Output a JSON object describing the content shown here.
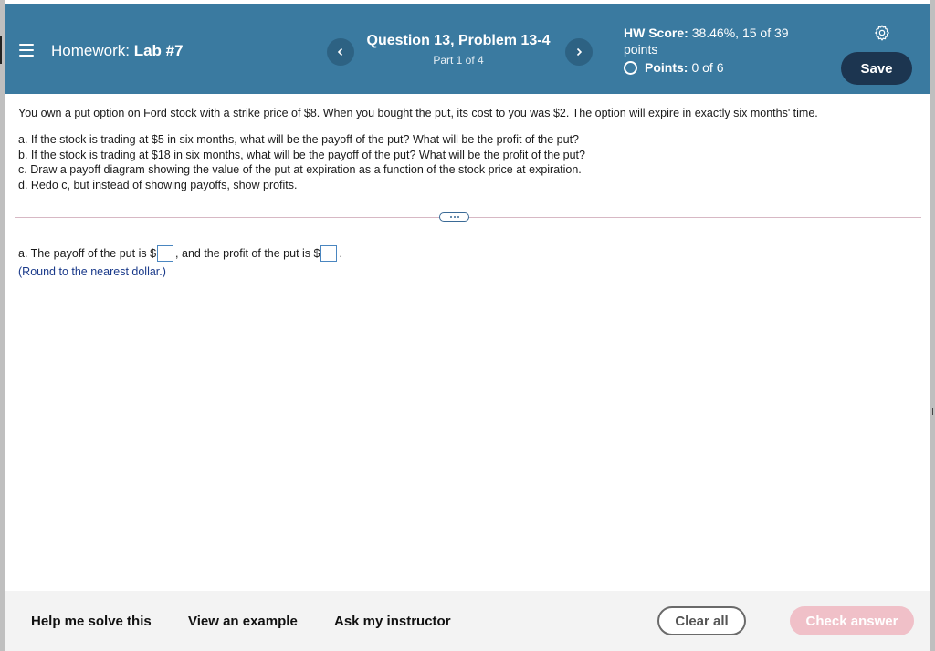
{
  "header": {
    "homework_prefix": "Homework:",
    "homework_name": "Lab #7",
    "question_title": "Question 13, Problem 13-4",
    "question_part": "Part 1 of 4",
    "hw_score_label": "HW Score:",
    "hw_score_value": "38.46%, 15 of 39",
    "hw_score_suffix": "points",
    "points_label": "Points:",
    "points_value": "0 of 6",
    "save_label": "Save",
    "prev_icon": "chevron-left-icon",
    "next_icon": "chevron-right-icon",
    "settings_icon": "gear-icon"
  },
  "problem": {
    "intro": "You own a put option on Ford stock with a strike price of $8. When you bought the put, its cost to you was $2. The option will expire in exactly six months' time.",
    "items": [
      "a. If the stock is trading at $5 in six months, what will be the payoff of the put? What will be the profit of the put?",
      "b. If the stock is trading at $18 in six months, what will be the payoff of the put? What will be the profit of the put?",
      "c. Draw a payoff diagram showing the value of the put at expiration as a function of the stock price at expiration.",
      "d. Redo c, but instead of showing payoffs, show profits."
    ]
  },
  "answer": {
    "part1": "a. The payoff of the put is $",
    "part2": ", and the profit of the put is $",
    "part3": ".",
    "payoff_value": "",
    "profit_value": "",
    "hint": "(Round to the nearest dollar.)"
  },
  "footer": {
    "help_label": "Help me solve this",
    "example_label": "View an example",
    "instructor_label": "Ask my instructor",
    "clear_label": "Clear all",
    "check_label": "Check answer"
  },
  "colors": {
    "header_bg": "#3a7aa0",
    "save_bg": "#1c3550",
    "check_bg": "#f0c0c8",
    "hint_text": "#1a3a8a"
  }
}
